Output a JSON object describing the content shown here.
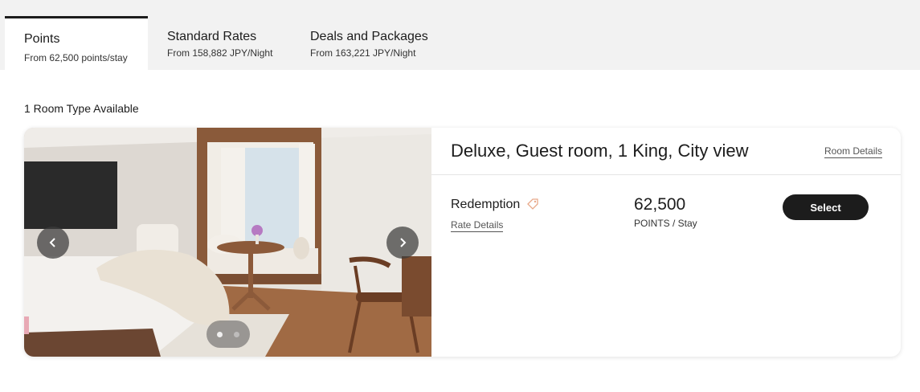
{
  "tabs": [
    {
      "title": "Points",
      "subtitle": "From 62,500 points/stay",
      "active": true
    },
    {
      "title": "Standard Rates",
      "subtitle": "From 158,882 JPY/Night",
      "active": false
    },
    {
      "title": "Deals and Packages",
      "subtitle": "From 163,221 JPY/Night",
      "active": false
    }
  ],
  "rooms_available": "1 Room Type Available",
  "room": {
    "title": "Deluxe, Guest room, 1 King, City view",
    "details_link": "Room Details",
    "image": {
      "current_slide": 1,
      "total_slides": 2
    }
  },
  "rate": {
    "name": "Redemption",
    "details_link": "Rate Details",
    "points": "62,500",
    "unit": "POINTS / Stay",
    "select_label": "Select"
  },
  "icons": {
    "prev": "chevron-left-icon",
    "next": "chevron-right-icon",
    "tag": "tag-icon"
  },
  "colors": {
    "accent": "#1c1c1c",
    "tag": "#e8a98a"
  }
}
